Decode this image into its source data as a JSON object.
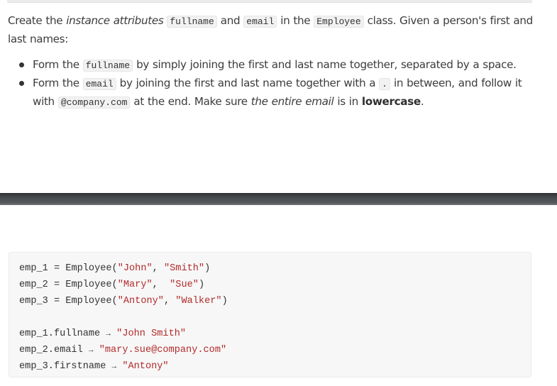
{
  "intro": {
    "part1": "Create the ",
    "em1": "instance attributes",
    "space1": " ",
    "code_fullname": "fullname",
    "part2": " and ",
    "code_email": "email",
    "part3": " in the ",
    "code_employee": "Employee",
    "part4": " class. Given a person's first and last names:"
  },
  "rules": [
    {
      "part1": "Form the ",
      "code": "fullname",
      "part2": " by simply joining the first and last name together, separated by a space."
    },
    {
      "part1": "Form the ",
      "code": "email",
      "part2": " by joining the first and last name together with a ",
      "code2": ".",
      "part3": " in between, and follow it with ",
      "code3": "@company.com",
      "part4": " at the end. Make sure ",
      "em": "the entire email",
      "part5": " is in ",
      "strong": "lowercase",
      "part6": "."
    }
  ],
  "code_example": {
    "constructors": [
      {
        "var": "emp_1",
        "op": " = ",
        "call": "Employee(",
        "arg1": "\"John\"",
        "sep": ", ",
        "arg2": "\"Smith\"",
        "close": ")"
      },
      {
        "var": "emp_2",
        "op": " = ",
        "call": "Employee(",
        "arg1": "\"Mary\"",
        "sep": ",  ",
        "arg2": "\"Sue\"",
        "close": ")"
      },
      {
        "var": "emp_3",
        "op": " = ",
        "call": "Employee(",
        "arg1": "\"Antony\"",
        "sep": ", ",
        "arg2": "\"Walker\"",
        "close": ")"
      }
    ],
    "arrow": "→",
    "results": [
      {
        "expr": "emp_1.fullname",
        "value": "\"John Smith\""
      },
      {
        "expr": "emp_2.email",
        "value": "\"mary.sue@company.com\""
      },
      {
        "expr": "emp_3.firstname",
        "value": "\"Antony\""
      }
    ]
  },
  "colors": {
    "string": "#b22b2b",
    "text": "#3c3c3c",
    "code_bg": "#f7f7f7",
    "divider": "#44484b"
  }
}
